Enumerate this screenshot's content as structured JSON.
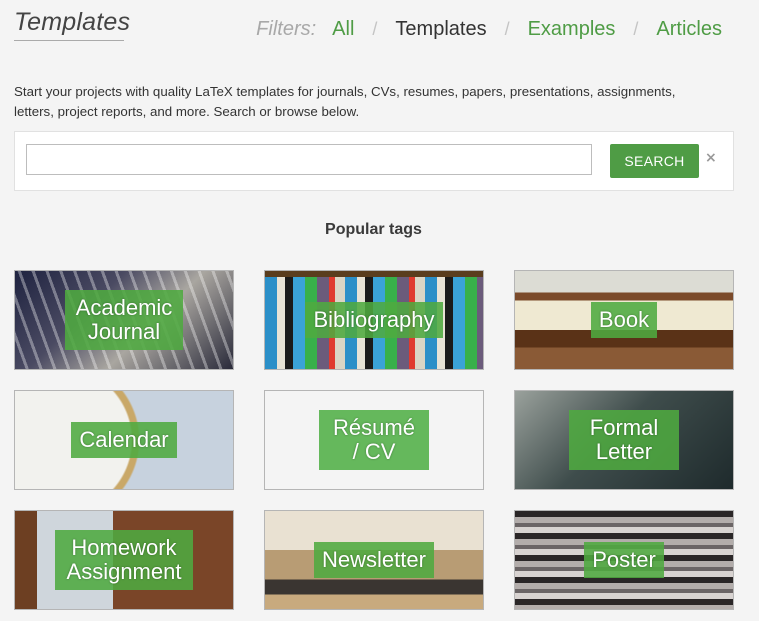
{
  "header": {
    "title": "Templates",
    "filters_label": "Filters:",
    "filters": [
      {
        "label": "All",
        "active": false
      },
      {
        "label": "Templates",
        "active": true
      },
      {
        "label": "Examples",
        "active": false
      },
      {
        "label": "Articles",
        "active": false
      }
    ],
    "separator": "/"
  },
  "intro": "Start your projects with quality LaTeX templates for journals, CVs, resumes, papers, presentations, assignments, letters, project reports, and more. Search or browse below.",
  "search": {
    "value": "",
    "placeholder": "",
    "button_label": "SEARCH",
    "clear_label": "×"
  },
  "popular_tags": {
    "heading": "Popular tags",
    "tags": [
      {
        "label": "Academic Journal",
        "image": "library-stairs-photo"
      },
      {
        "label": "Bibliography",
        "image": "bookshelf-photo"
      },
      {
        "label": "Book",
        "image": "open-book-photo"
      },
      {
        "label": "Calendar",
        "image": "clock-photo"
      },
      {
        "label": "Résumé / CV",
        "image": "none"
      },
      {
        "label": "Formal Letter",
        "image": "typewriter-photo"
      },
      {
        "label": "Homework Assignment",
        "image": "desk-laptop-photo"
      },
      {
        "label": "Newsletter",
        "image": "desk-window-photo"
      },
      {
        "label": "Poster",
        "image": "blurred-posters-photo"
      }
    ]
  },
  "colors": {
    "accent": "#4f9c45",
    "tag_overlay": "#4eaa40",
    "background": "#f4f4f4"
  }
}
